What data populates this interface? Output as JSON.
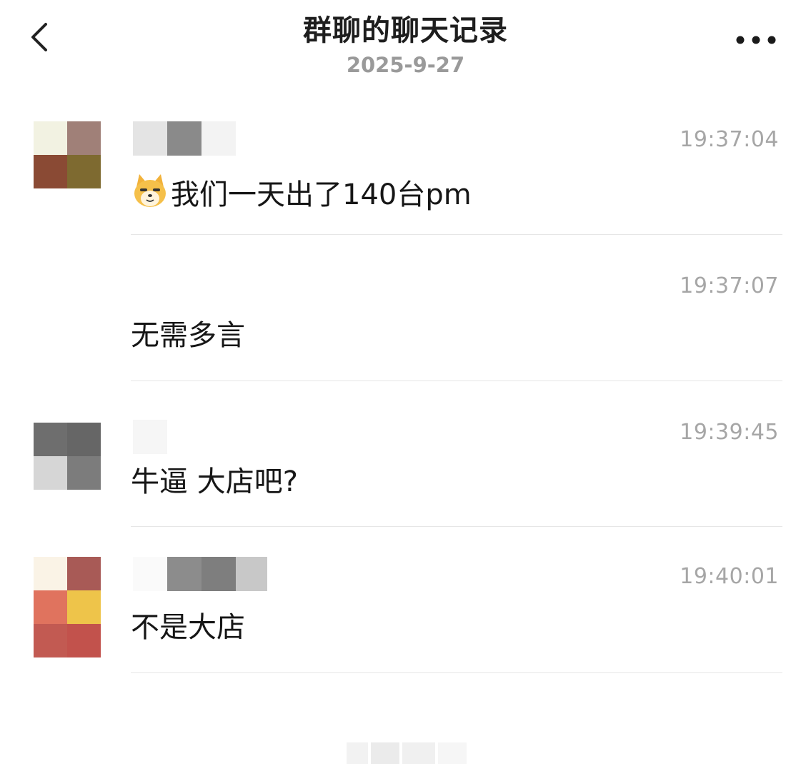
{
  "header": {
    "title": "群聊的聊天记录",
    "date": "2025-9-27",
    "back_icon": "chevron-left-icon",
    "more_icon": "ellipsis-icon"
  },
  "messages": [
    {
      "time": "19:37:04",
      "text": "我们一天出了140台pm",
      "emoji": "doge-cat-emoji",
      "avatar_colors": [
        "#f2f2e2",
        "#a08078",
        "#8a4a34",
        "#7e6a30"
      ]
    },
    {
      "time": "19:37:07",
      "text": "无需多言"
    },
    {
      "time": "19:39:45",
      "text": "牛逼 大店吧?",
      "avatar_colors": [
        "#6e6e6e",
        "#666666",
        "#d6d6d6",
        "#7c7c7c"
      ]
    },
    {
      "time": "19:40:01",
      "text": "不是大店",
      "avatar_colors": [
        "#faf3e6",
        "#a85a56",
        "#e0735e",
        "#eec44a",
        "#c25a52",
        "#c2524c"
      ]
    }
  ]
}
